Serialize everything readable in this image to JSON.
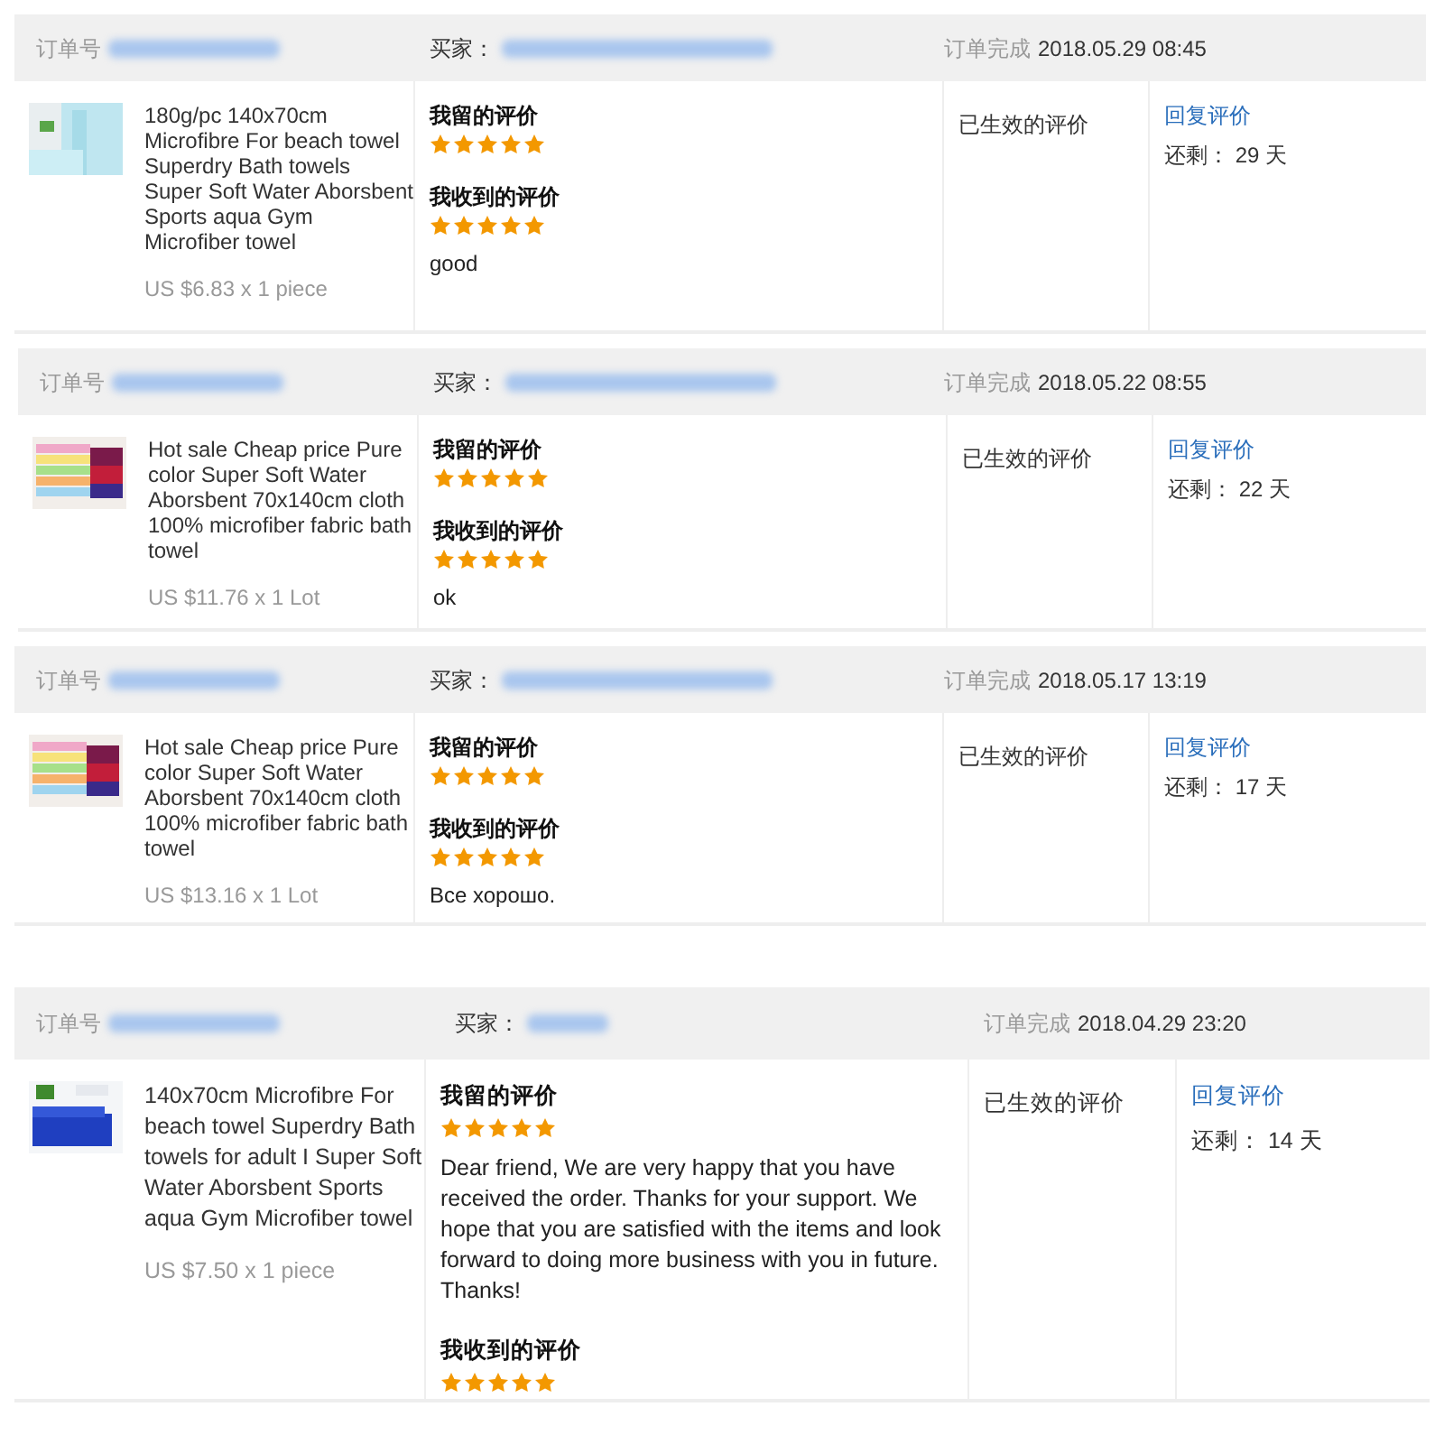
{
  "orders": [
    {
      "order_label": "订单号",
      "buyer_label": "买家：",
      "completed_label": "订单完成",
      "completed_time": "2018.05.29 08:45",
      "product": {
        "title": "180g/pc 140x70cm Microfibre For beach towel Superdry Bath towels Super Soft Water Aborsbent Sports aqua Gym Microfiber towel",
        "price": "US $6.83 x 1 piece"
      },
      "reviews": [
        {
          "heading": "我留的评价",
          "stars": 5
        },
        {
          "heading": "我收到的评价",
          "stars": 5,
          "comment": "good"
        }
      ],
      "status": "已生效的评价",
      "reply_link": "回复评价",
      "remaining": "还剩： 29 天"
    },
    {
      "order_label": "订单号",
      "buyer_label": "买家：",
      "completed_label": "订单完成",
      "completed_time": "2018.05.22 08:55",
      "product": {
        "title": "Hot sale Cheap price Pure color Super Soft Water Aborsbent 70x140cm cloth 100% microfiber fabric bath towel",
        "price": "US $11.76 x 1 Lot"
      },
      "reviews": [
        {
          "heading": "我留的评价",
          "stars": 5
        },
        {
          "heading": "我收到的评价",
          "stars": 5,
          "comment": "ok"
        }
      ],
      "status": "已生效的评价",
      "reply_link": "回复评价",
      "remaining": "还剩： 22 天"
    },
    {
      "order_label": "订单号",
      "buyer_label": "买家：",
      "completed_label": "订单完成",
      "completed_time": "2018.05.17 13:19",
      "product": {
        "title": "Hot sale Cheap price Pure color Super Soft Water Aborsbent 70x140cm cloth 100% microfiber fabric bath towel",
        "price": "US $13.16 x 1 Lot"
      },
      "reviews": [
        {
          "heading": "我留的评价",
          "stars": 5
        },
        {
          "heading": "我收到的评价",
          "stars": 5,
          "comment": "Все хорошо."
        }
      ],
      "status": "已生效的评价",
      "reply_link": "回复评价",
      "remaining": "还剩： 17 天"
    },
    {
      "order_label": "订单号",
      "buyer_label": "买家：",
      "completed_label": "订单完成",
      "completed_time": "2018.04.29 23:20",
      "product": {
        "title": "140x70cm Microfibre For beach towel Superdry Bath towels for adult I Super Soft Water Aborsbent Sports aqua Gym Microfiber towel",
        "price": "US $7.50 x 1 piece"
      },
      "reviews": [
        {
          "heading": "我留的评价",
          "stars": 5,
          "comment": "Dear friend, We are very happy that you have received the order. Thanks for your support. We hope that you are satisfied with the items and look forward to doing more business with you in future. Thanks!"
        },
        {
          "heading": "我收到的评价",
          "stars": 5
        }
      ],
      "status": "已生效的评价",
      "reply_link": "回复评价",
      "remaining": "还剩： 14 天"
    }
  ]
}
